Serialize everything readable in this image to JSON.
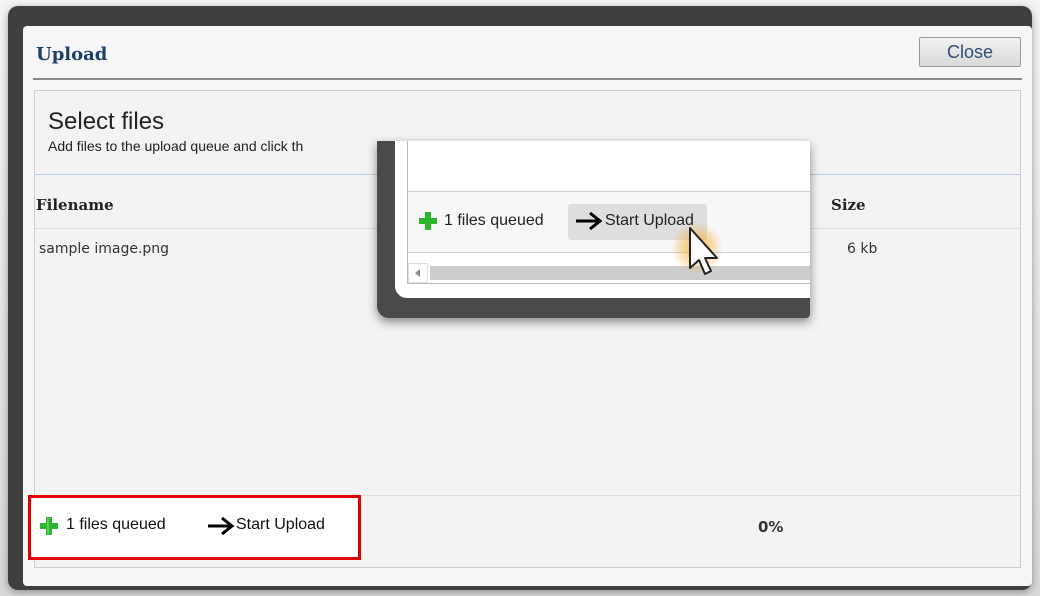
{
  "dialog": {
    "title": "Upload",
    "close_label": "Close"
  },
  "uploader": {
    "heading": "Select files",
    "subtitle": "Add files to the upload queue and click th",
    "columns": {
      "filename": "Filename",
      "size": "Size"
    },
    "files": [
      {
        "name": "sample image.png",
        "size": "6 kb"
      }
    ],
    "footer": {
      "queued_label": "1 files queued",
      "start_label": "Start Upload",
      "progress": "0%"
    }
  },
  "zoom_inset": {
    "queued_label": "1 files queued",
    "start_label": "Start Upload"
  },
  "icons": {
    "add": "plus-icon",
    "start": "arrow-right-icon",
    "cursor": "pointer-cursor-icon"
  },
  "colors": {
    "title_blue": "#1c3f6b",
    "highlight_red": "#e00000",
    "plus_green": "#2db52d",
    "cursor_glow": "#f5a623"
  }
}
